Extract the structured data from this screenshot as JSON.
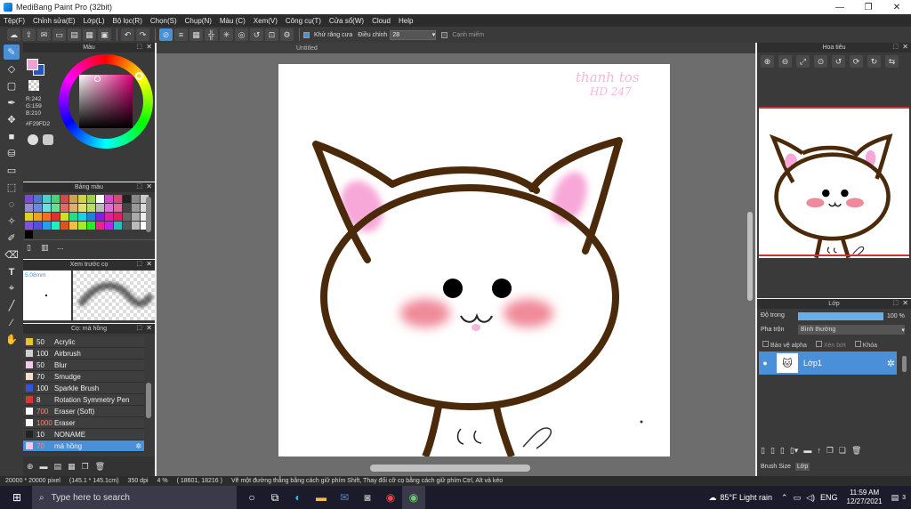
{
  "window": {
    "title": "MediBang Paint Pro (32bit)",
    "minimize": "—",
    "maximize": "❐",
    "close": "✕"
  },
  "menu": [
    "Tệp(F)",
    "Chỉnh sửa(E)",
    "Lớp(L)",
    "Bộ lọc(R)",
    "Chọn(S)",
    "Chụp(N)",
    "Màu (C)",
    "Xem(V)",
    "Công cụ(T)",
    "Cửa sổ(W)",
    "Cloud",
    "Help"
  ],
  "toolbar": {
    "antialias": "Khử răng cưa",
    "adjust_label": "Điều chỉnh",
    "adjust_value": "28",
    "snap": "Cạnh miếm"
  },
  "color_panel": {
    "title": "Màu",
    "r": "R:242",
    "g": "G:159",
    "b": "B:210",
    "hex": "#F29FD2",
    "fg": "#F29FD2",
    "bg": "#2255cc"
  },
  "swatch_panel": {
    "title": "Bảng màu",
    "extra": "..."
  },
  "preview_panel": {
    "title": "Xem trước cọ",
    "size": "5.08mm"
  },
  "brush_panel": {
    "title": "Cọ: má hồng",
    "items": [
      {
        "size": "50",
        "name": "Acrylic",
        "color": "#e8c32a",
        "sizecolor": "#eeeeee"
      },
      {
        "size": "100",
        "name": "Airbrush",
        "color": "#d0d0d0",
        "sizecolor": "#eeeeee"
      },
      {
        "size": "50",
        "name": "Blur",
        "color": "#f4c8e8",
        "sizecolor": "#eeeeee"
      },
      {
        "size": "70",
        "name": "Smudge",
        "color": "#f4e0c8",
        "sizecolor": "#eeeeee"
      },
      {
        "size": "100",
        "name": "Sparkle Brush",
        "color": "#3355dd",
        "sizecolor": "#eeeeee"
      },
      {
        "size": "8",
        "name": "Rotation Symmetry Pen",
        "color": "#dd3333",
        "sizecolor": "#eeeeee"
      },
      {
        "size": "700",
        "name": "Eraser (Soft)",
        "color": "#ffffff",
        "sizecolor": "#ff8080"
      },
      {
        "size": "1000",
        "name": "Eraser",
        "color": "#ffffff",
        "sizecolor": "#ff8080"
      },
      {
        "size": "10",
        "name": "NONAME",
        "color": "#222222",
        "sizecolor": "#eeeeee"
      },
      {
        "size": "70",
        "name": "má hồng",
        "color": "#f4c8e8",
        "sizecolor": "#ff8080"
      }
    ]
  },
  "canvas": {
    "tab": "Untitled",
    "signature": "thanh tos\nHD 247"
  },
  "navigator": {
    "title": "Hoa tiêu"
  },
  "layers": {
    "title": "Lớp",
    "opacity_label": "Độ trong",
    "opacity_value": "100 %",
    "opacity_fraction": 1.0,
    "blend_label": "Pha trộn",
    "blend_value": "Bình thường",
    "protect_alpha": "Bảo vệ alpha",
    "clip": "Xén bớt",
    "lock": "Khóa",
    "layer_name": "Lớp1",
    "tab1": "Brush Size",
    "tab2": "Lớp"
  },
  "status": {
    "size": "20000 * 20000 pixel",
    "phys": "(145.1 * 145.1cm)",
    "dpi": "350 dpi",
    "zoom": "4 %",
    "coords": "( 18601, 18216 )",
    "hint": "Vẽ một đường thẳng bằng cách giữ phím Shift, Thay đổi cỡ cọ bằng cách giữ phím Ctrl, Alt và kéo"
  },
  "taskbar": {
    "search": "Type here to search",
    "weather": "85°F  Light rain",
    "lang": "ENG",
    "time": "11:59 AM",
    "date": "12/27/2021",
    "notif": "3"
  }
}
